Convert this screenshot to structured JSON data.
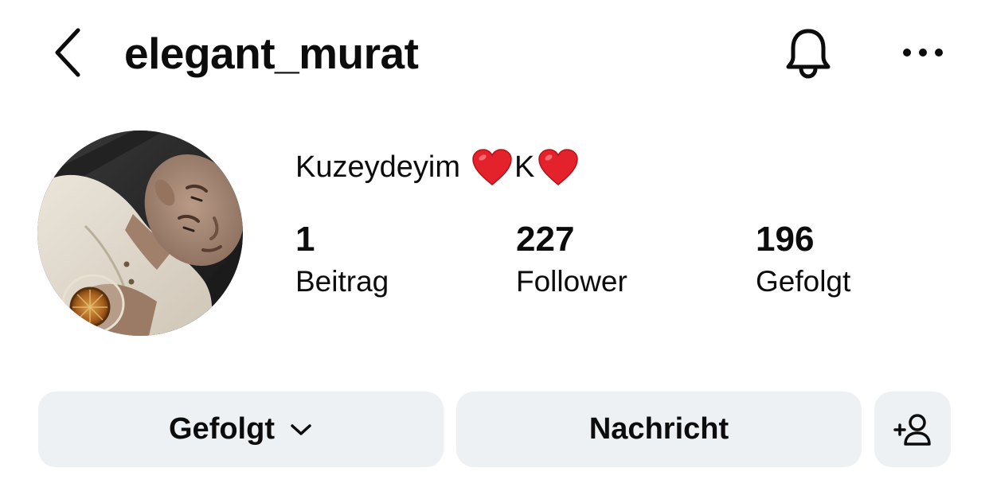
{
  "header": {
    "username": "elegant_murat",
    "back_icon": "chevron-left-icon",
    "notifications_icon": "bell-icon",
    "more_icon": "more-horizontal-icon"
  },
  "profile": {
    "avatar_icon": "profile-photo",
    "display_name": {
      "text": "Kuzeydeyim",
      "letter": "K",
      "emoji": "red-heart-icon",
      "heart_color": "#e3222b"
    },
    "stats": {
      "posts": {
        "value": "1",
        "label": "Beitrag"
      },
      "followers": {
        "value": "227",
        "label": "Follower"
      },
      "following": {
        "value": "196",
        "label": "Gefolgt"
      }
    }
  },
  "actions": {
    "following_label": "Gefolgt",
    "following_icon": "chevron-down-icon",
    "message_label": "Nachricht",
    "add_user_icon": "add-person-icon",
    "button_bg": "#eef1f4"
  }
}
